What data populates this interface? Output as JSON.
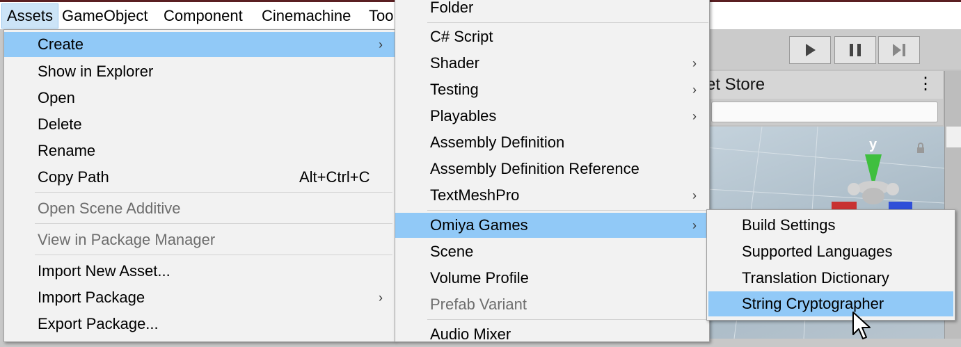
{
  "menubar": {
    "items": [
      "Assets",
      "GameObject",
      "Component",
      "Cinemachine",
      "Too"
    ]
  },
  "editor": {
    "asset_store_tab": "et Store",
    "gizmo_axis_label": "y"
  },
  "assets_menu": {
    "items": [
      {
        "label": "Create",
        "highlighted": true,
        "submenu": true
      },
      {
        "label": "Show in Explorer"
      },
      {
        "label": "Open"
      },
      {
        "label": "Delete"
      },
      {
        "label": "Rename"
      },
      {
        "label": "Copy Path",
        "shortcut": "Alt+Ctrl+C"
      },
      {
        "label": "Open Scene Additive",
        "disabled": true
      },
      {
        "label": "View in Package Manager",
        "disabled": true
      },
      {
        "label": "Import New Asset..."
      },
      {
        "label": "Import Package",
        "submenu": true
      },
      {
        "label": "Export Package..."
      }
    ]
  },
  "create_menu": {
    "items": [
      {
        "label": "Folder"
      },
      {
        "label": "C# Script"
      },
      {
        "label": "Shader",
        "submenu": true
      },
      {
        "label": "Testing",
        "submenu": true
      },
      {
        "label": "Playables",
        "submenu": true
      },
      {
        "label": "Assembly Definition"
      },
      {
        "label": "Assembly Definition Reference"
      },
      {
        "label": "TextMeshPro",
        "submenu": true
      },
      {
        "label": "Omiya Games",
        "highlighted": true,
        "submenu": true
      },
      {
        "label": "Scene"
      },
      {
        "label": "Volume Profile"
      },
      {
        "label": "Prefab Variant",
        "disabled": true
      },
      {
        "label": "Audio Mixer"
      }
    ]
  },
  "omiya_menu": {
    "items": [
      {
        "label": "Build Settings"
      },
      {
        "label": "Supported Languages"
      },
      {
        "label": "Translation Dictionary"
      },
      {
        "label": "String Cryptographer",
        "highlighted": true
      }
    ]
  },
  "icons": {
    "submenu_arrow": "chevron-right-icon",
    "play": "play-icon",
    "pause": "pause-icon",
    "step": "step-icon",
    "lock": "lock-icon",
    "kebab": "kebab-menu-icon",
    "cursor": "mouse-cursor-icon"
  },
  "colors": {
    "highlight": "#91c9f7",
    "menu_bg": "#f2f2f2",
    "menubar_selected": "#cce4f7",
    "gizmo_green": "#3fbf3f",
    "gizmo_red": "#c83232",
    "gizmo_blue": "#2f4fd8"
  }
}
